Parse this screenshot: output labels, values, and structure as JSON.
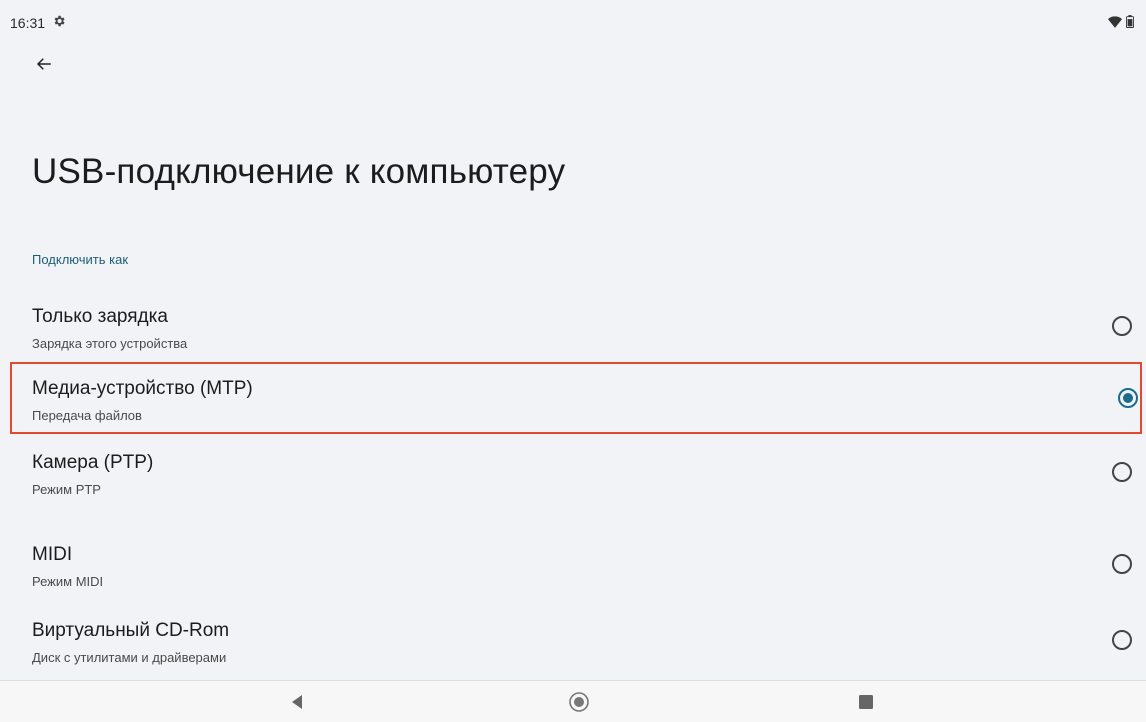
{
  "status_bar": {
    "time": "16:31",
    "icons": [
      "settings-gear-icon",
      "wifi-icon",
      "battery-icon"
    ]
  },
  "header": {
    "back_icon": "arrow-back-icon",
    "title": "USB-подключение к компьютеру"
  },
  "section": {
    "label": "Подключить как"
  },
  "options": [
    {
      "title": "Только зарядка",
      "subtitle": "Зарядка этого устройства",
      "selected": false
    },
    {
      "title": "Медиа-устройство (MTP)",
      "subtitle": "Передача файлов",
      "selected": true
    },
    {
      "title": "Камера (PTP)",
      "subtitle": "Режим PTP",
      "selected": false
    },
    {
      "title": "MIDI",
      "subtitle": "Режим MIDI",
      "selected": false
    },
    {
      "title": "Виртуальный CD-Rom",
      "subtitle": "Диск с утилитами и драйверами",
      "selected": false
    }
  ],
  "nav_bar": {
    "icons": [
      "nav-back-icon",
      "nav-home-icon",
      "nav-recents-icon"
    ]
  },
  "colors": {
    "accent": "#1a6e8c",
    "highlight_border": "#e24a2e",
    "background": "#f1f3f6"
  }
}
